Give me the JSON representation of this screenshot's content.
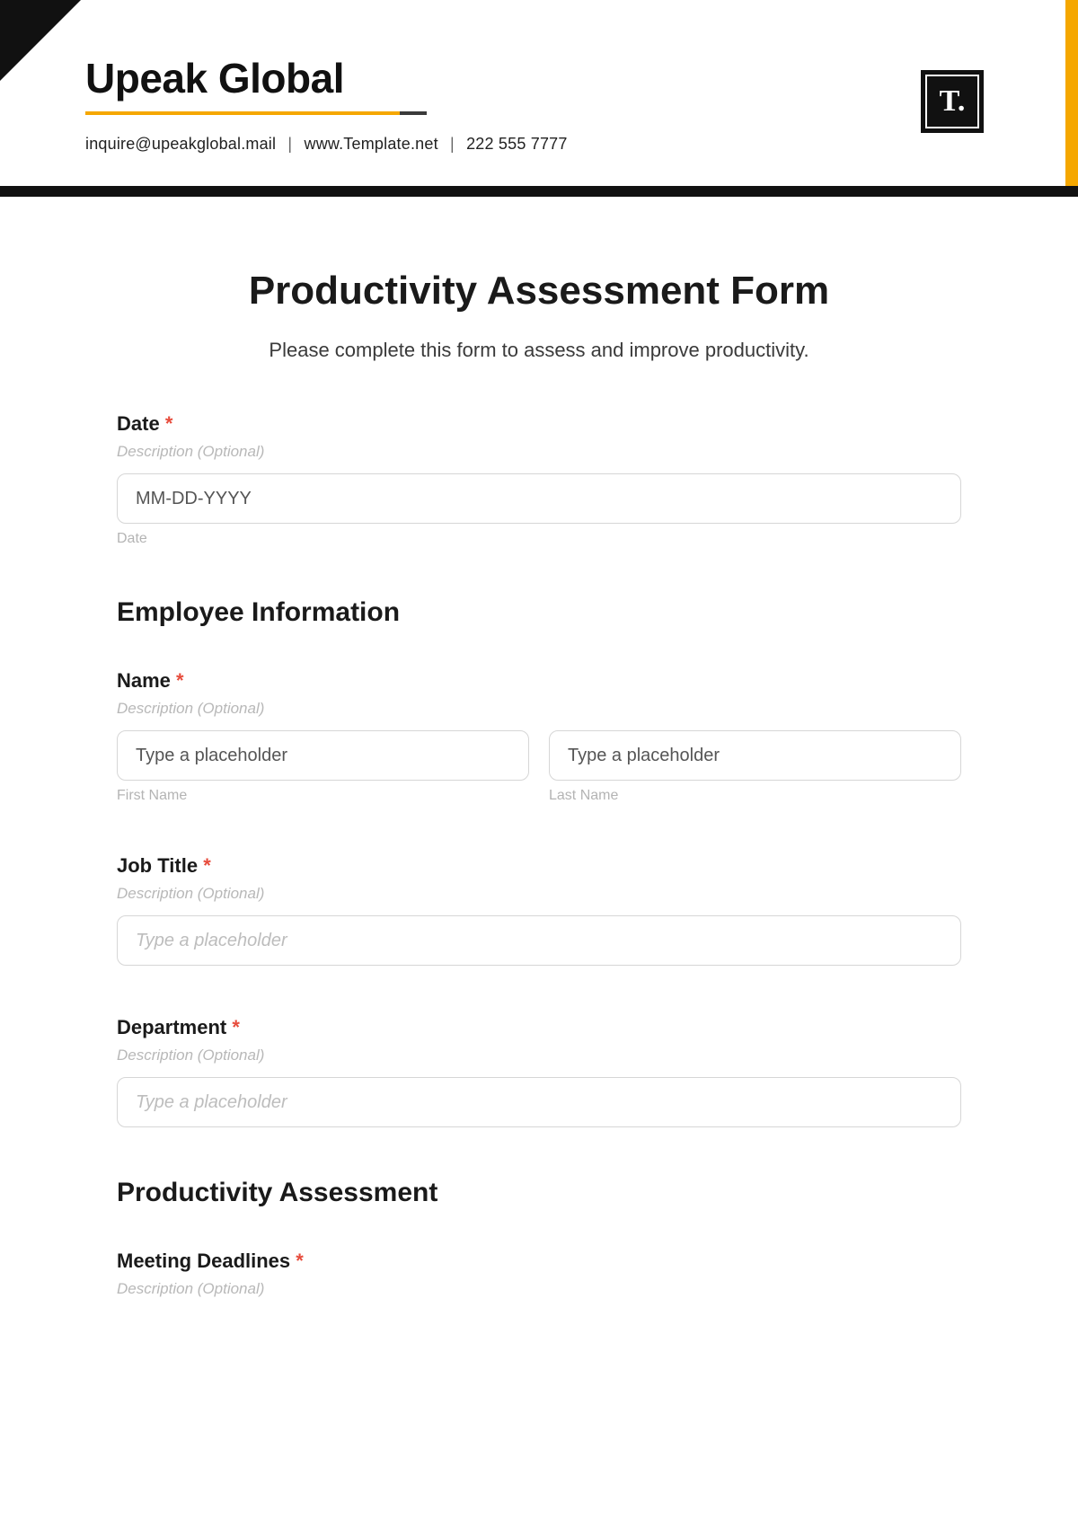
{
  "header": {
    "company": "Upeak Global",
    "email": "inquire@upeakglobal.mail",
    "website": "www.Template.net",
    "phone": "222 555 7777",
    "logo_text": "T."
  },
  "form": {
    "title": "Productivity Assessment Form",
    "subtitle": "Please complete this form to assess and improve productivity.",
    "desc_placeholder": "Description (Optional)",
    "required_mark": "*",
    "date_field": {
      "label": "Date",
      "placeholder": "MM-DD-YYYY",
      "sublabel": "Date"
    },
    "section_employee": "Employee Information",
    "name_field": {
      "label": "Name",
      "first_placeholder": "Type a placeholder",
      "last_placeholder": "Type a placeholder",
      "first_sublabel": "First Name",
      "last_sublabel": "Last Name"
    },
    "jobtitle_field": {
      "label": "Job Title",
      "placeholder": "Type a placeholder"
    },
    "department_field": {
      "label": "Department",
      "placeholder": "Type a placeholder"
    },
    "section_productivity": "Productivity Assessment",
    "deadlines_field": {
      "label": "Meeting Deadlines"
    }
  }
}
